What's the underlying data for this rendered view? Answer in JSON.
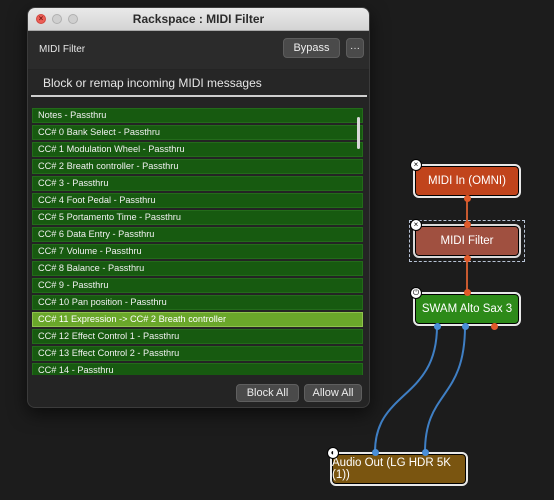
{
  "window": {
    "title": "Rackspace : MIDI Filter",
    "close_glyph": "×"
  },
  "toolbar": {
    "plugin_name": "MIDI Filter",
    "bypass_label": "Bypass",
    "more_label": "···"
  },
  "header": {
    "text": "Block or remap incoming MIDI messages"
  },
  "rows": [
    {
      "text": "Notes - Passthru",
      "active": false
    },
    {
      "text": "CC# 0 Bank Select - Passthru",
      "active": false
    },
    {
      "text": "CC# 1 Modulation Wheel - Passthru",
      "active": false
    },
    {
      "text": "CC# 2 Breath controller - Passthru",
      "active": false
    },
    {
      "text": "CC# 3 - Passthru",
      "active": false
    },
    {
      "text": "CC# 4 Foot Pedal - Passthru",
      "active": false
    },
    {
      "text": "CC# 5 Portamento Time - Passthru",
      "active": false
    },
    {
      "text": "CC# 6 Data Entry - Passthru",
      "active": false
    },
    {
      "text": "CC# 7 Volume - Passthru",
      "active": false
    },
    {
      "text": "CC# 8 Balance - Passthru",
      "active": false
    },
    {
      "text": "CC# 9 - Passthru",
      "active": false
    },
    {
      "text": "CC# 10 Pan position - Passthru",
      "active": false
    },
    {
      "text": "CC# 11 Expression -> CC# 2 Breath controller",
      "active": true
    },
    {
      "text": "CC# 12 Effect Control 1 - Passthru",
      "active": false
    },
    {
      "text": "CC# 13 Effect Control 2 - Passthru",
      "active": false
    },
    {
      "text": "CC# 14 - Passthru",
      "active": false
    }
  ],
  "buttons": {
    "block_all": "Block All",
    "allow_all": "Allow All"
  },
  "graph": {
    "nodes": {
      "midi_in": "MIDI In (OMNI)",
      "midi_filter": "MIDI Filter",
      "swam": "SWAM Alto Sax 3",
      "audio_out": "Audio Out (LG HDR 5K (1))"
    },
    "badges": {
      "close": "×",
      "power": "⏻",
      "input": "◐"
    }
  },
  "colors": {
    "midi_node": "#c1441c",
    "filter_node": "#a05040",
    "plugin_node": "#2d8a19",
    "audio_node": "#7a5510",
    "midi_wire": "#c85a30",
    "audio_wire": "#3f7fc4",
    "row_bg": "#175a10",
    "row_active": "#6aa72a"
  }
}
